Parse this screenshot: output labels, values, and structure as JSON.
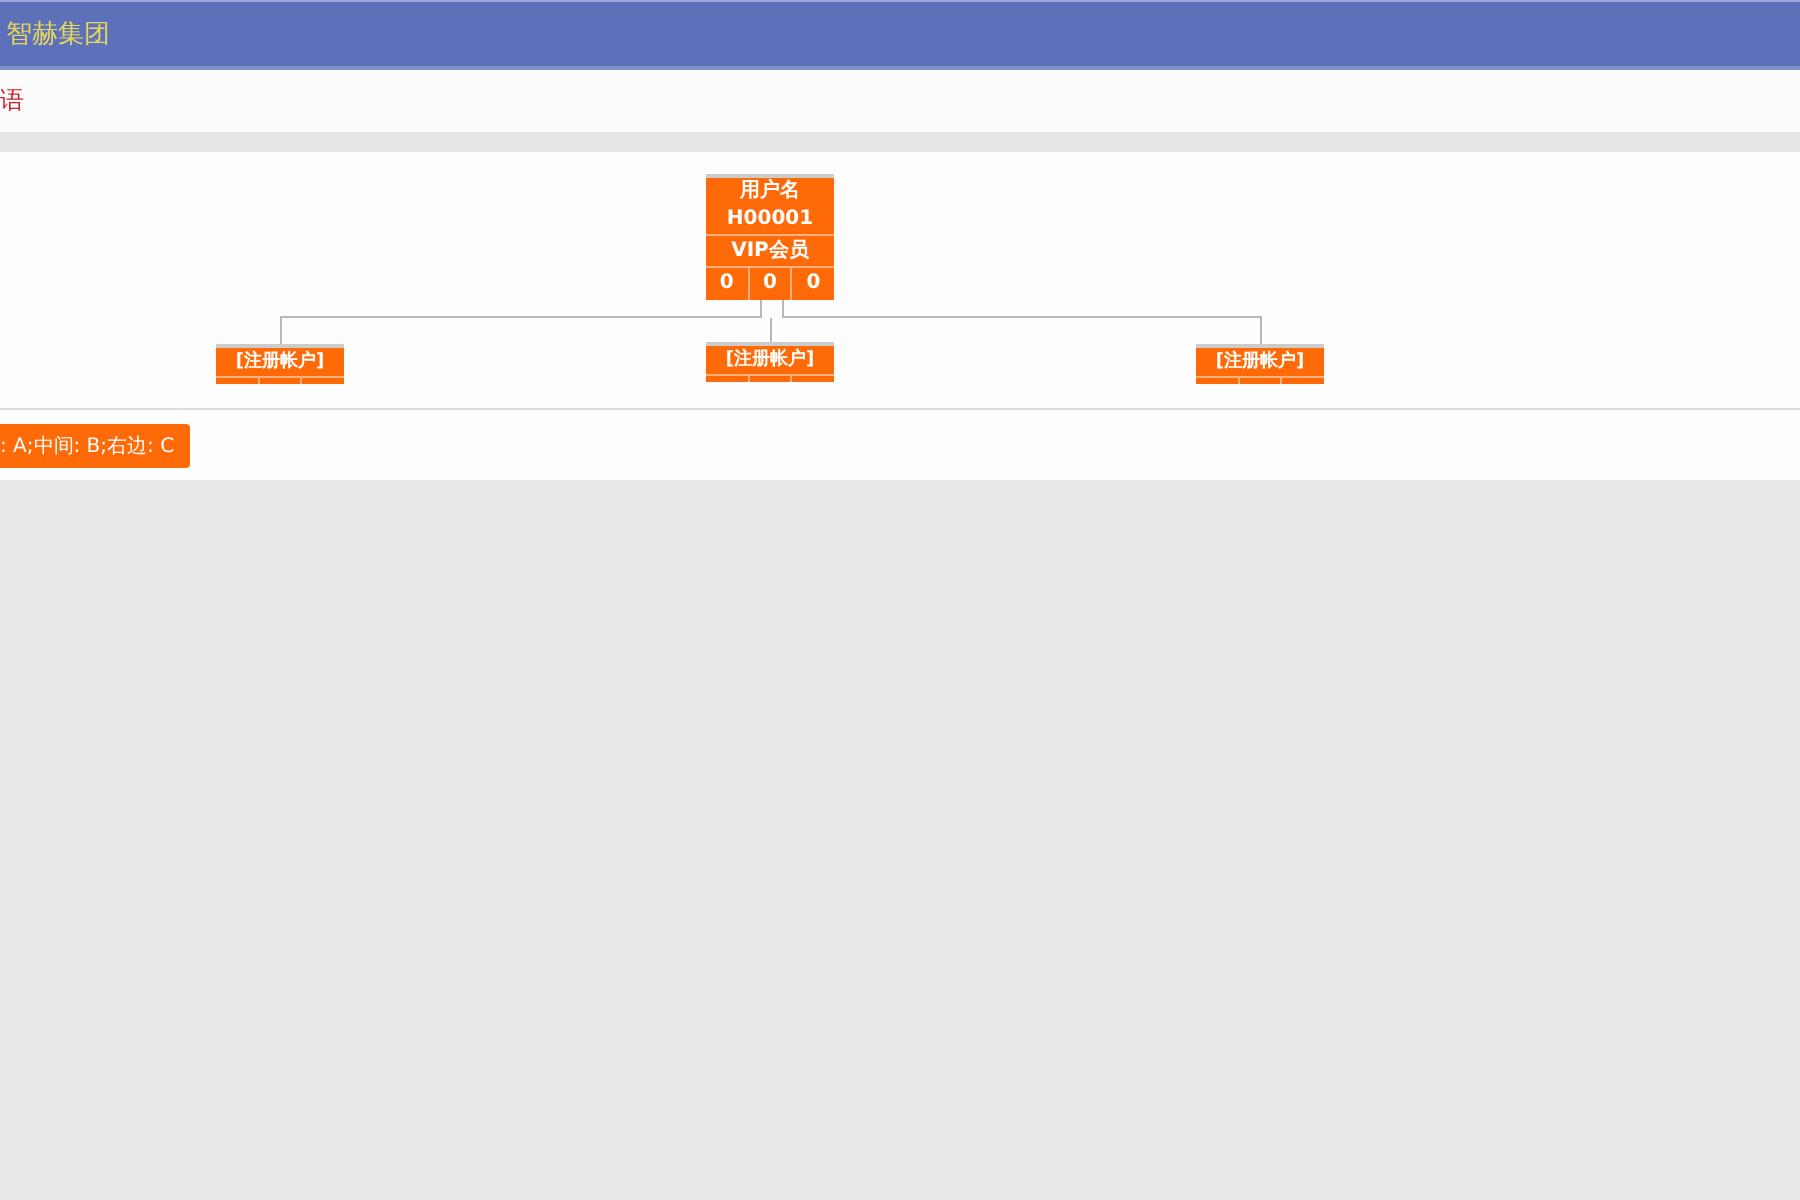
{
  "header": {
    "title": "智赫集团"
  },
  "notice": {
    "text": "语"
  },
  "tree": {
    "root": {
      "label": "用户名",
      "id": "H00001",
      "level": "VIP会员",
      "counts": [
        "0",
        "0",
        "0"
      ]
    },
    "children": [
      {
        "label": "[注册帐户]"
      },
      {
        "label": "[注册帐户]"
      },
      {
        "label": "[注册帐户]"
      }
    ]
  },
  "legend_button": {
    "label": ": A;中间: B;右边: C"
  }
}
